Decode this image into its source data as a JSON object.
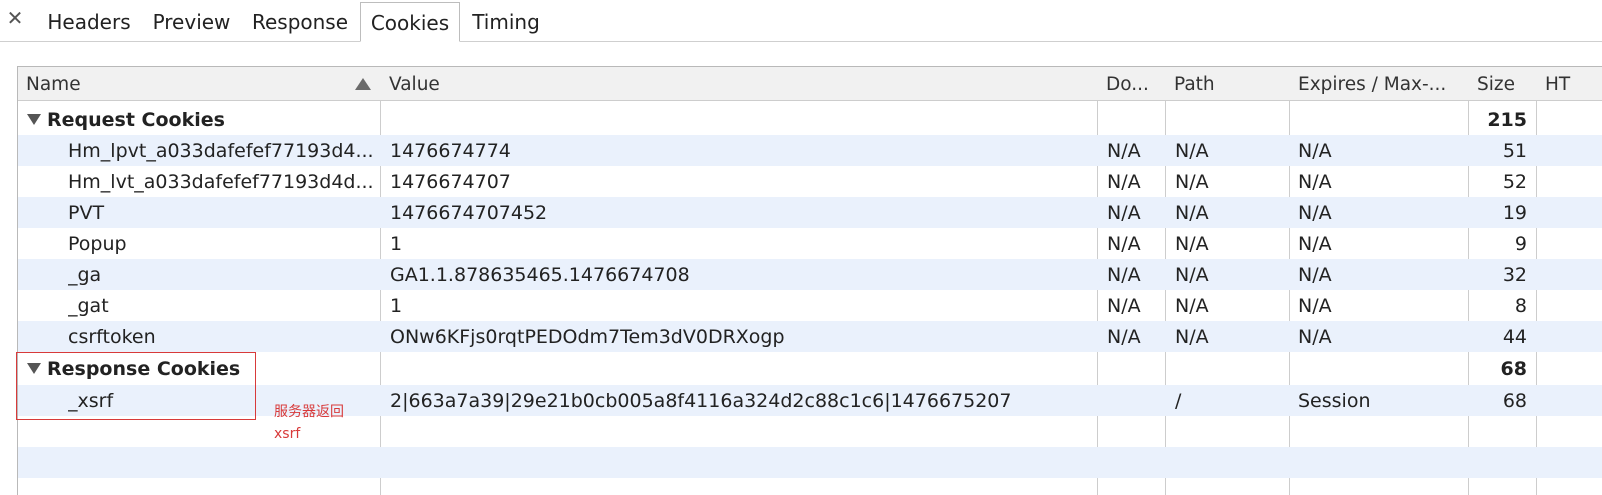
{
  "tabbar": {
    "close_glyph": "✕",
    "tabs": [
      {
        "label": "Headers",
        "active": false
      },
      {
        "label": "Preview",
        "active": false
      },
      {
        "label": "Response",
        "active": false
      },
      {
        "label": "Cookies",
        "active": true
      },
      {
        "label": "Timing",
        "active": false
      }
    ]
  },
  "table": {
    "columns": [
      "Name",
      "Value",
      "Do...",
      "Path",
      "Expires / Max-...",
      "Size",
      "HT"
    ],
    "sort": {
      "column": "Name",
      "direction": "ascending"
    },
    "request_group": {
      "label": "Request Cookies",
      "size": "215"
    },
    "request_rows": [
      {
        "name": "Hm_lpvt_a033dafefef77193d4...",
        "value": "1476674774",
        "domain": "N/A",
        "path": "N/A",
        "expires": "N/A",
        "size": "51"
      },
      {
        "name": "Hm_lvt_a033dafefef77193d4d...",
        "value": "1476674707",
        "domain": "N/A",
        "path": "N/A",
        "expires": "N/A",
        "size": "52"
      },
      {
        "name": "PVT",
        "value": "1476674707452",
        "domain": "N/A",
        "path": "N/A",
        "expires": "N/A",
        "size": "19"
      },
      {
        "name": "Popup",
        "value": "1",
        "domain": "N/A",
        "path": "N/A",
        "expires": "N/A",
        "size": "9"
      },
      {
        "name": "_ga",
        "value": "GA1.1.878635465.1476674708",
        "domain": "N/A",
        "path": "N/A",
        "expires": "N/A",
        "size": "32"
      },
      {
        "name": "_gat",
        "value": "1",
        "domain": "N/A",
        "path": "N/A",
        "expires": "N/A",
        "size": "8"
      },
      {
        "name": "csrftoken",
        "value": "ONw6KFjs0rqtPEDOdm7Tem3dV0DRXogp",
        "domain": "N/A",
        "path": "N/A",
        "expires": "N/A",
        "size": "44"
      }
    ],
    "response_group": {
      "label": "Response Cookies",
      "size": "68"
    },
    "response_rows": [
      {
        "name": "_xsrf",
        "value": "2|663a7a39|29e21b0cb005a8f4116a324d2c88c1c6|1476675207",
        "domain": "",
        "path": "/",
        "expires": "Session",
        "size": "68"
      }
    ]
  },
  "annotation": {
    "text": "服务器返回\nxsrf",
    "color": "#d83a3a"
  },
  "colors": {
    "stripe": "#eaf1fc",
    "header_bg": "#f1f1f1",
    "grid_line": "#cdcdcd"
  }
}
